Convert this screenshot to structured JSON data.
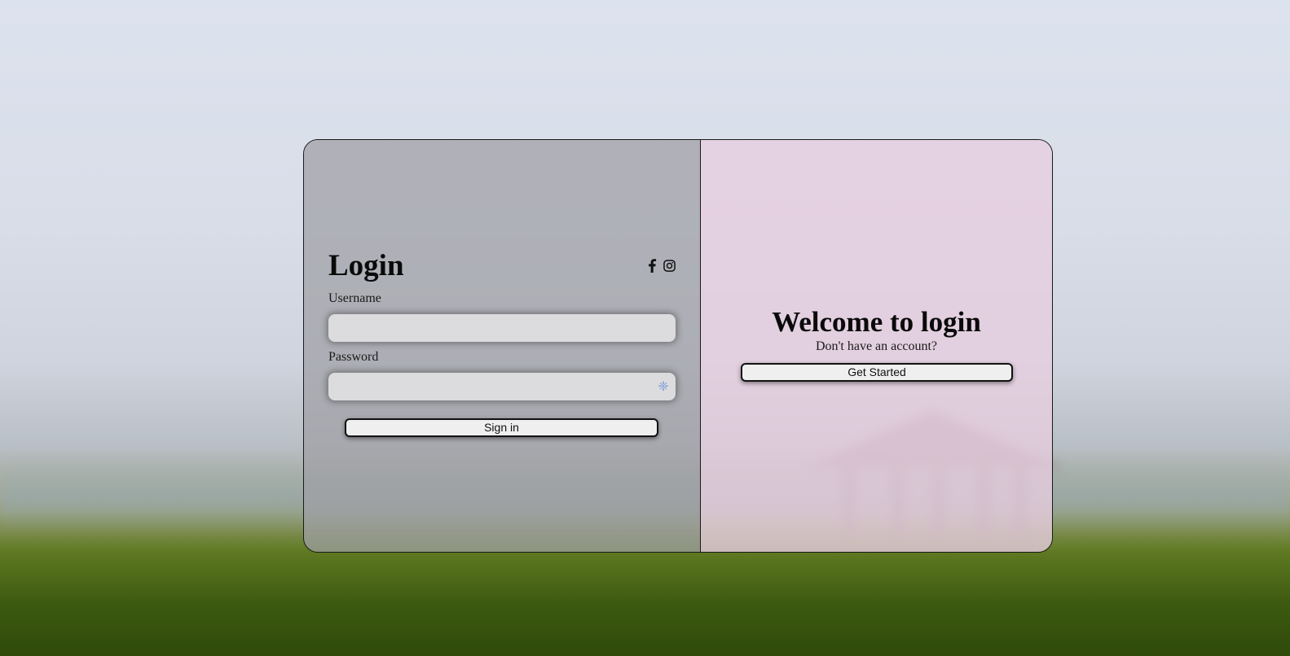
{
  "login": {
    "title": "Login",
    "username_label": "Username",
    "username_value": "",
    "password_label": "Password",
    "password_value": "",
    "signin_label": "Sign in"
  },
  "socials": {
    "icons": [
      "facebook-icon",
      "instagram-icon"
    ]
  },
  "welcome": {
    "title": "Welcome to login",
    "subtext": "Don't have an account?",
    "get_started_label": "Get Started"
  },
  "colors": {
    "left_panel": "#a0a0a5",
    "right_panel": "#e6cdde",
    "button_bg": "#efefef",
    "password_icon": "#7c9bd8"
  }
}
